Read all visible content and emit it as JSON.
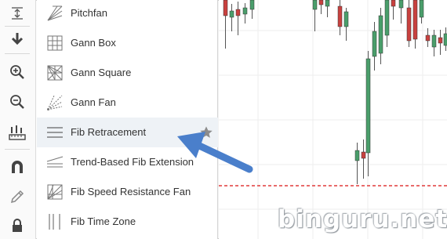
{
  "toolbar": {
    "buttons": [
      {
        "name": "measure-icon"
      },
      {
        "name": "down-arrow-icon"
      },
      {
        "name": "zoom-in-icon"
      },
      {
        "name": "zoom-out-icon"
      },
      {
        "name": "ruler-icon"
      },
      {
        "name": "magnet-icon"
      },
      {
        "name": "pencil-icon"
      },
      {
        "name": "lock-icon"
      }
    ]
  },
  "menu": {
    "items": [
      {
        "label": "Pitchfan",
        "icon": "pitchfan-icon"
      },
      {
        "label": "Gann Box",
        "icon": "gann-box-icon"
      },
      {
        "label": "Gann Square",
        "icon": "gann-square-icon"
      },
      {
        "label": "Gann Fan",
        "icon": "gann-fan-icon"
      },
      {
        "label": "Fib Retracement",
        "icon": "fib-retracement-icon",
        "active": true,
        "favorite_icon": "star-icon"
      },
      {
        "label": "Trend-Based Fib Extension",
        "icon": "trend-fib-extension-icon"
      },
      {
        "label": "Fib Speed Resistance Fan",
        "icon": "fib-speed-fan-icon"
      },
      {
        "label": "Fib Time Zone",
        "icon": "fib-time-zone-icon"
      }
    ]
  },
  "colors": {
    "bull": "#4a9e6b",
    "bear": "#c9413f",
    "price_line": "#e03a3a",
    "highlight": "#eef2f6",
    "arrow": "#4a7fcb"
  },
  "watermark": "binguru.net"
}
